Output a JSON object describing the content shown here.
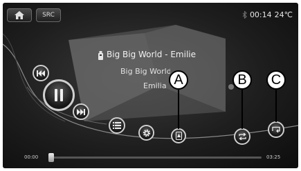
{
  "header": {
    "home_icon": "home-icon",
    "src_label": "SRC",
    "bluetooth_icon": "bluetooth-icon",
    "clock": "00:14",
    "temperature": "24℃"
  },
  "track": {
    "title": "Big Big World - Emilie",
    "album": "Big Big World",
    "artist": "Emilia"
  },
  "controls": {
    "prev_icon": "skip-previous-icon",
    "pause_icon": "pause-icon",
    "next_icon": "skip-next-icon",
    "list_icon": "list-icon",
    "settings_icon": "gear-icon",
    "scan_icon": "scan-icon",
    "repeat_icon": "repeat-icon",
    "shuffle_icon": "shuffle-icon"
  },
  "callouts": {
    "a": "A",
    "b": "B",
    "c": "C"
  },
  "progress": {
    "elapsed": "00:00",
    "total": "03:25",
    "fraction": 0.0
  },
  "colors": {
    "background": "#1e1e1e",
    "accent": "#cfcfcf"
  }
}
